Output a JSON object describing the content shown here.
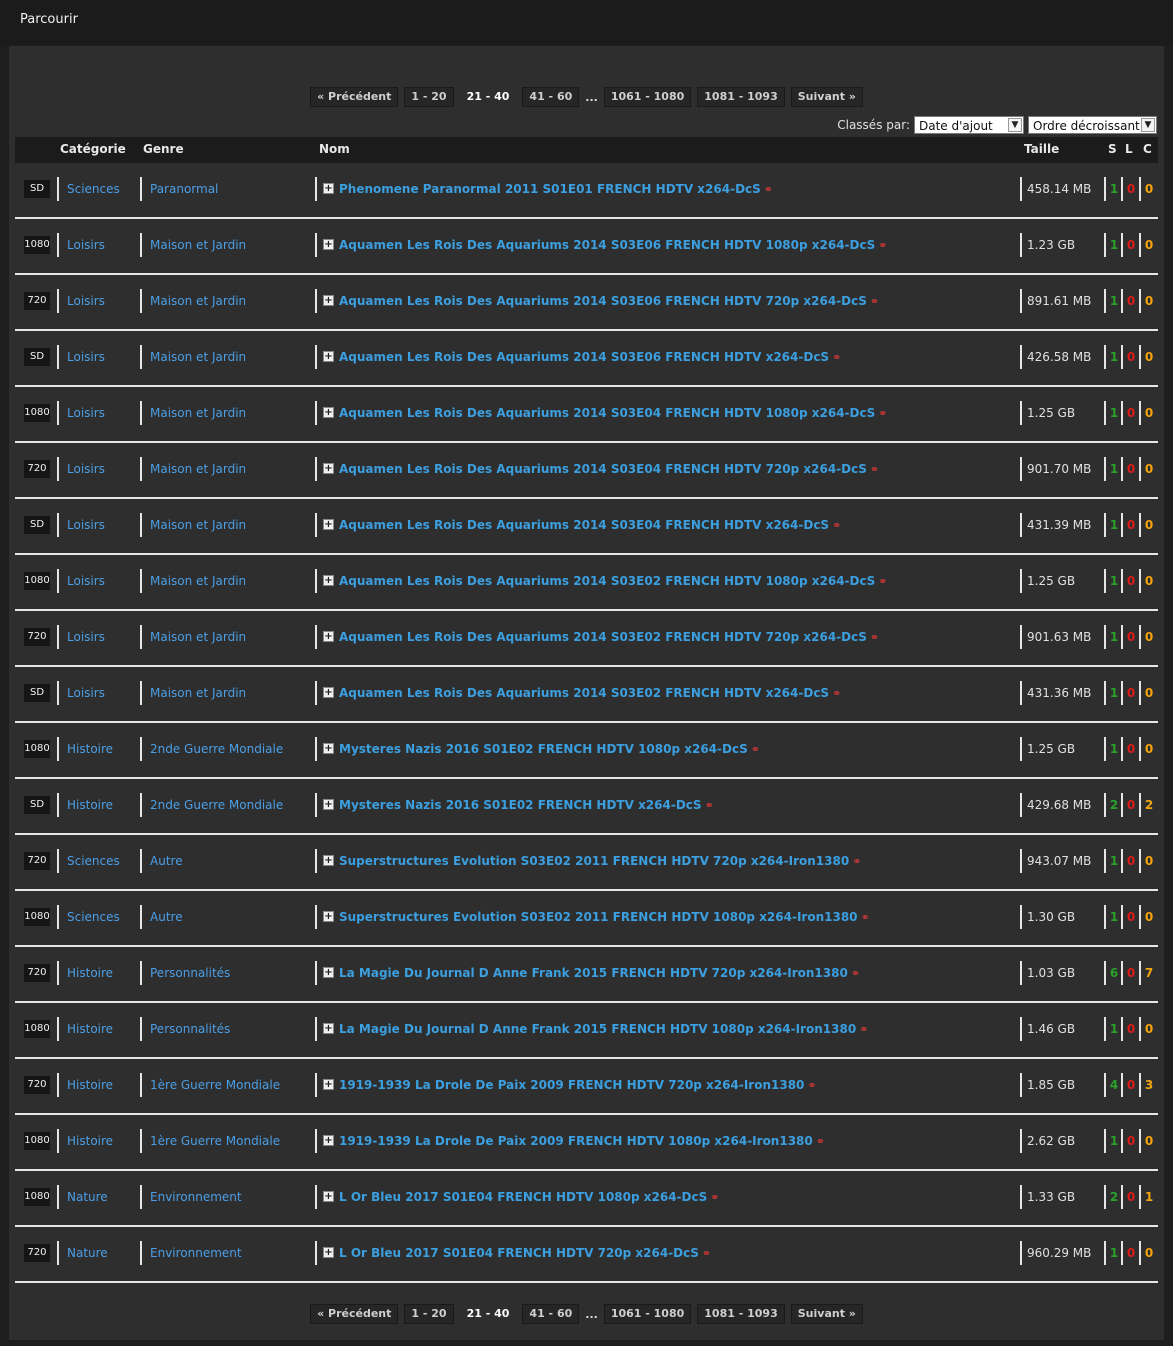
{
  "header": {
    "title": "Parcourir"
  },
  "pagination": {
    "prev_label": "« Précédent",
    "pages": [
      "1 - 20",
      "21 - 40",
      "41 - 60"
    ],
    "ellipsis": "...",
    "tail_pages": [
      "1061 - 1080",
      "1081 - 1093"
    ],
    "next_label": "Suivant »",
    "current": "21 - 40"
  },
  "sort": {
    "label": "Classés par:",
    "field_selected": "Date d'ajout",
    "order_selected": "Ordre décroissant"
  },
  "table": {
    "columns": {
      "categorie": "Catégorie",
      "genre": "Genre",
      "nom": "Nom",
      "taille": "Taille",
      "s": "S",
      "l": "L",
      "c": "C"
    },
    "rows": [
      {
        "quality": "SD",
        "categorie": "Sciences",
        "genre": "Paranormal",
        "nom": "Phenomene Paranormal 2011 S01E01 FRENCH HDTV x264-DcS",
        "taille": "458.14 MB",
        "s": "1",
        "l": "0",
        "c": "0"
      },
      {
        "quality": "1080",
        "categorie": "Loisirs",
        "genre": "Maison et Jardin",
        "nom": "Aquamen Les Rois Des Aquariums 2014 S03E06 FRENCH HDTV 1080p x264-DcS",
        "taille": "1.23 GB",
        "s": "1",
        "l": "0",
        "c": "0"
      },
      {
        "quality": "720",
        "categorie": "Loisirs",
        "genre": "Maison et Jardin",
        "nom": "Aquamen Les Rois Des Aquariums 2014 S03E06 FRENCH HDTV 720p x264-DcS",
        "taille": "891.61 MB",
        "s": "1",
        "l": "0",
        "c": "0"
      },
      {
        "quality": "SD",
        "categorie": "Loisirs",
        "genre": "Maison et Jardin",
        "nom": "Aquamen Les Rois Des Aquariums 2014 S03E06 FRENCH HDTV x264-DcS",
        "taille": "426.58 MB",
        "s": "1",
        "l": "0",
        "c": "0"
      },
      {
        "quality": "1080",
        "categorie": "Loisirs",
        "genre": "Maison et Jardin",
        "nom": "Aquamen Les Rois Des Aquariums 2014 S03E04 FRENCH HDTV 1080p x264-DcS",
        "taille": "1.25 GB",
        "s": "1",
        "l": "0",
        "c": "0"
      },
      {
        "quality": "720",
        "categorie": "Loisirs",
        "genre": "Maison et Jardin",
        "nom": "Aquamen Les Rois Des Aquariums 2014 S03E04 FRENCH HDTV 720p x264-DcS",
        "taille": "901.70 MB",
        "s": "1",
        "l": "0",
        "c": "0"
      },
      {
        "quality": "SD",
        "categorie": "Loisirs",
        "genre": "Maison et Jardin",
        "nom": "Aquamen Les Rois Des Aquariums 2014 S03E04 FRENCH HDTV x264-DcS",
        "taille": "431.39 MB",
        "s": "1",
        "l": "0",
        "c": "0"
      },
      {
        "quality": "1080",
        "categorie": "Loisirs",
        "genre": "Maison et Jardin",
        "nom": "Aquamen Les Rois Des Aquariums 2014 S03E02 FRENCH HDTV 1080p x264-DcS",
        "taille": "1.25 GB",
        "s": "1",
        "l": "0",
        "c": "0"
      },
      {
        "quality": "720",
        "categorie": "Loisirs",
        "genre": "Maison et Jardin",
        "nom": "Aquamen Les Rois Des Aquariums 2014 S03E02 FRENCH HDTV 720p x264-DcS",
        "taille": "901.63 MB",
        "s": "1",
        "l": "0",
        "c": "0"
      },
      {
        "quality": "SD",
        "categorie": "Loisirs",
        "genre": "Maison et Jardin",
        "nom": "Aquamen Les Rois Des Aquariums 2014 S03E02 FRENCH HDTV x264-DcS",
        "taille": "431.36 MB",
        "s": "1",
        "l": "0",
        "c": "0"
      },
      {
        "quality": "1080",
        "categorie": "Histoire",
        "genre": "2nde Guerre Mondiale",
        "nom": "Mysteres Nazis 2016 S01E02 FRENCH HDTV 1080p x264-DcS",
        "taille": "1.25 GB",
        "s": "1",
        "l": "0",
        "c": "0"
      },
      {
        "quality": "SD",
        "categorie": "Histoire",
        "genre": "2nde Guerre Mondiale",
        "nom": "Mysteres Nazis 2016 S01E02 FRENCH HDTV x264-DcS",
        "taille": "429.68 MB",
        "s": "2",
        "l": "0",
        "c": "2"
      },
      {
        "quality": "720",
        "categorie": "Sciences",
        "genre": "Autre",
        "nom": "Superstructures Evolution S03E02 2011 FRENCH HDTV 720p x264-Iron1380",
        "taille": "943.07 MB",
        "s": "1",
        "l": "0",
        "c": "0"
      },
      {
        "quality": "1080",
        "categorie": "Sciences",
        "genre": "Autre",
        "nom": "Superstructures Evolution S03E02 2011 FRENCH HDTV 1080p x264-Iron1380",
        "taille": "1.30 GB",
        "s": "1",
        "l": "0",
        "c": "0"
      },
      {
        "quality": "720",
        "categorie": "Histoire",
        "genre": "Personnalités",
        "nom": "La Magie Du Journal D Anne Frank 2015 FRENCH HDTV 720p x264-Iron1380",
        "taille": "1.03 GB",
        "s": "6",
        "l": "0",
        "c": "7"
      },
      {
        "quality": "1080",
        "categorie": "Histoire",
        "genre": "Personnalités",
        "nom": "La Magie Du Journal D Anne Frank 2015 FRENCH HDTV 1080p x264-Iron1380",
        "taille": "1.46 GB",
        "s": "1",
        "l": "0",
        "c": "0"
      },
      {
        "quality": "720",
        "categorie": "Histoire",
        "genre": "1ère Guerre Mondiale",
        "nom": "1919-1939 La Drole De Paix 2009 FRENCH HDTV 720p x264-Iron1380",
        "taille": "1.85 GB",
        "s": "4",
        "l": "0",
        "c": "3"
      },
      {
        "quality": "1080",
        "categorie": "Histoire",
        "genre": "1ère Guerre Mondiale",
        "nom": "1919-1939 La Drole De Paix 2009 FRENCH HDTV 1080p x264-Iron1380",
        "taille": "2.62 GB",
        "s": "1",
        "l": "0",
        "c": "0"
      },
      {
        "quality": "1080",
        "categorie": "Nature",
        "genre": "Environnement",
        "nom": "L Or Bleu 2017 S01E04 FRENCH HDTV 1080p x264-DcS",
        "taille": "1.33 GB",
        "s": "2",
        "l": "0",
        "c": "1"
      },
      {
        "quality": "720",
        "categorie": "Nature",
        "genre": "Environnement",
        "nom": "L Or Bleu 2017 S01E04 FRENCH HDTV 720p x264-DcS",
        "taille": "960.29 MB",
        "s": "1",
        "l": "0",
        "c": "0"
      }
    ]
  },
  "icons": {
    "expand": "plus-box-icon",
    "link": "chain-link-icon"
  },
  "colors": {
    "link": "#3b9fe0",
    "seed": "#2aa22a",
    "leech": "#e01b1b",
    "complete": "#f2a50f"
  }
}
